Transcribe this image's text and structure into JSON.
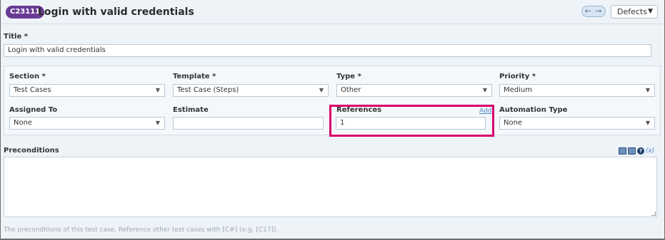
{
  "header": {
    "case_id": "C23111",
    "title": "Login with valid credentials",
    "nav_arrows": "← →",
    "defects_label": "Defects"
  },
  "title_field": {
    "label": "Title *",
    "value": "Login with valid credentials"
  },
  "fields": {
    "section": {
      "label": "Section *",
      "value": "Test Cases"
    },
    "template": {
      "label": "Template *",
      "value": "Test Case (Steps)"
    },
    "type": {
      "label": "Type *",
      "value": "Other"
    },
    "priority": {
      "label": "Priority *",
      "value": "Medium"
    },
    "assigned_to": {
      "label": "Assigned To",
      "value": "None"
    },
    "estimate": {
      "label": "Estimate",
      "value": ""
    },
    "references": {
      "label": "References",
      "value": "1",
      "add_link": "Add"
    },
    "automation_type": {
      "label": "Automation Type",
      "value": "None"
    }
  },
  "preconditions": {
    "label": "Preconditions",
    "value": "",
    "hint": "The preconditions of this test case. Reference other test cases with [C#] (e.g. [C17])."
  },
  "toolbar": {
    "help_glyph": "?",
    "var_glyph": "(x)",
    "icons": [
      "table-icon",
      "image-icon",
      "help-icon",
      "variable-icon"
    ]
  },
  "colors": {
    "accent": "#6a3a94",
    "highlight": "#d9006c",
    "link": "#4a86c7"
  }
}
